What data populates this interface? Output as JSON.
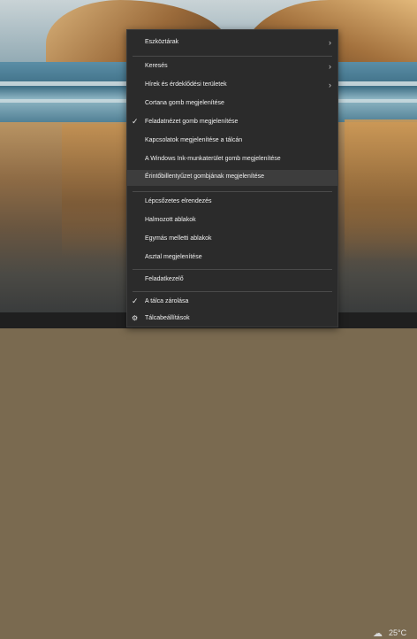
{
  "menu": {
    "items": [
      {
        "label": "Eszköztárak",
        "submenu": true
      },
      {
        "label": "Keresés",
        "submenu": true
      },
      {
        "label": "Hírek és érdeklődési területek",
        "submenu": true
      },
      {
        "label": "Cortana gomb megjelenítése"
      },
      {
        "label": "Feladatnézet gomb megjelenítése",
        "checked": true
      },
      {
        "label": "Kapcsolatok megjelenítése a tálcán"
      },
      {
        "label": "A Windows Ink-munkaterület gomb megjelenítése"
      },
      {
        "label": "Érintőbillentyűzet gombjának megjelenítése",
        "highlighted": true
      },
      {
        "label": "Lépcsőzetes elrendezés"
      },
      {
        "label": "Halmozott ablakok"
      },
      {
        "label": "Egymás melletti ablakok"
      },
      {
        "label": "Asztal megjelenítése"
      },
      {
        "label": "Feladatkezelő"
      },
      {
        "label": "A tálca zárolása",
        "checked": true
      },
      {
        "label": "Tálcabeállítások",
        "icon": "gear-icon"
      }
    ]
  },
  "taskbar": {
    "weather_icon": "cloud-icon",
    "temperature": "25°C"
  },
  "colors": {
    "menu_bg": "#2b2b2b",
    "highlight": "#3d3d3d",
    "text": "#f0f0f0"
  }
}
